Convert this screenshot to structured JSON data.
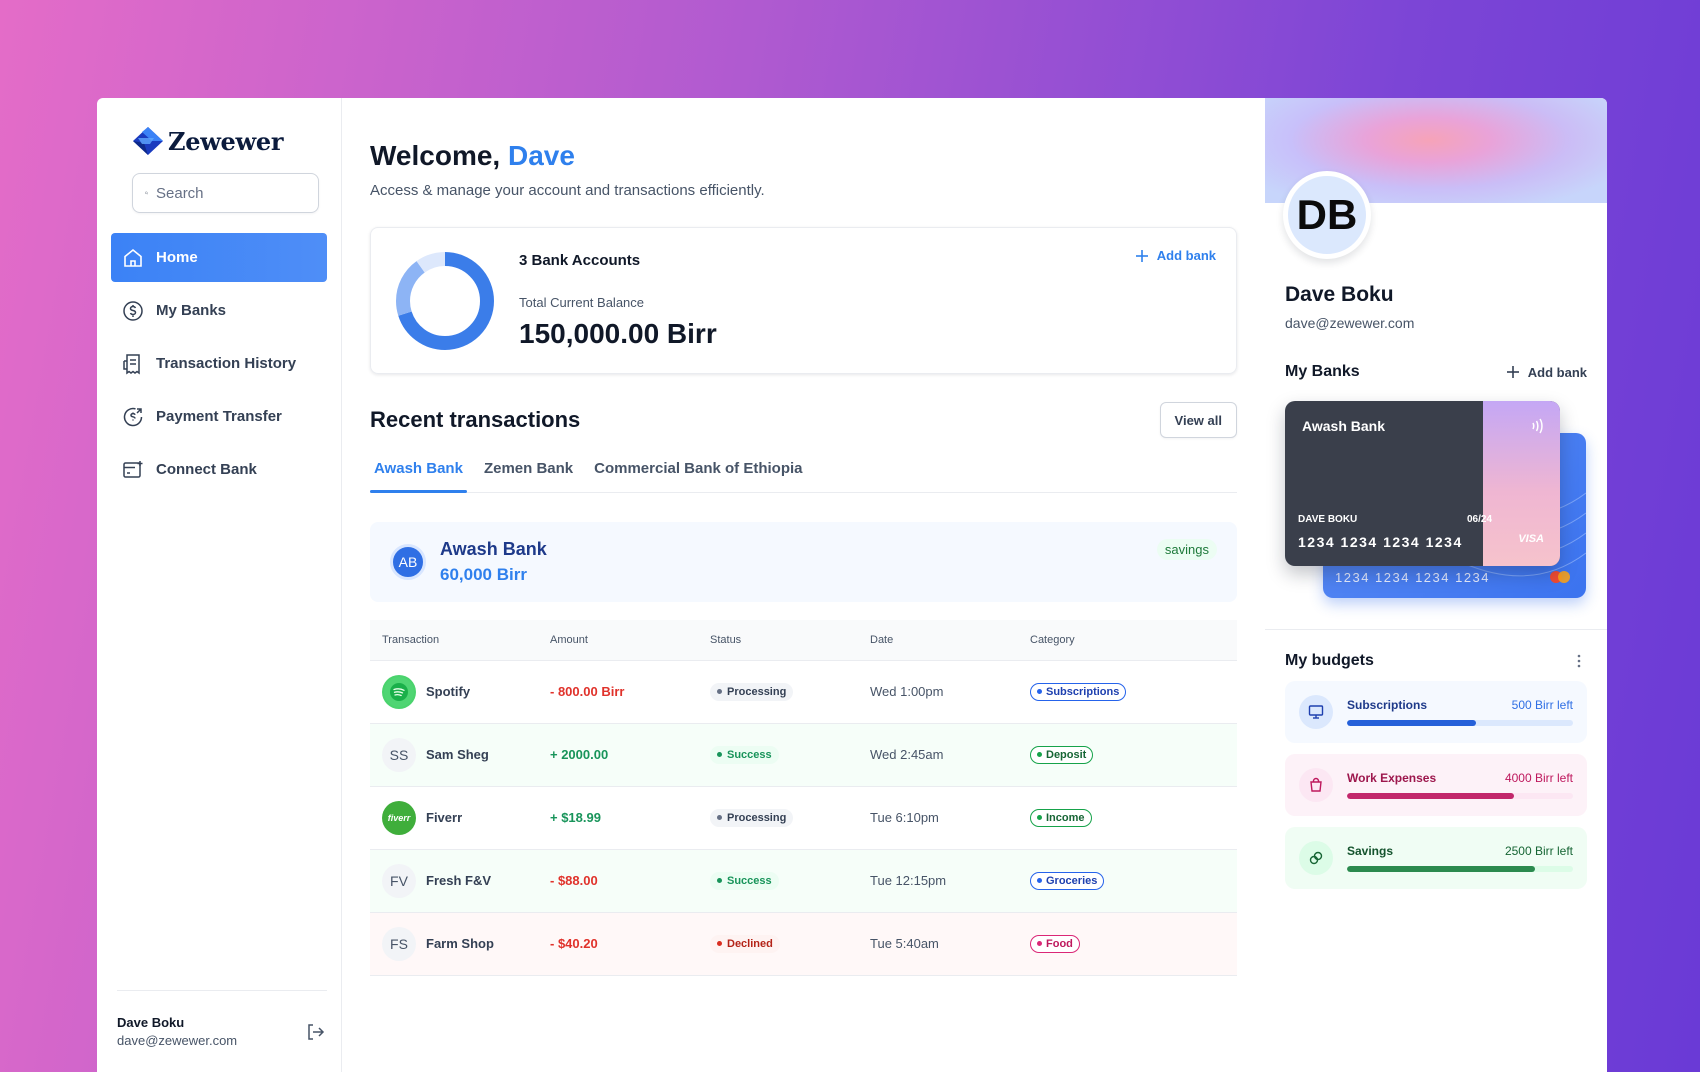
{
  "app": {
    "logo_text": "Zewewer"
  },
  "search": {
    "placeholder": "Search"
  },
  "sidebar": {
    "items": [
      {
        "label": "Home",
        "icon": "home-icon"
      },
      {
        "label": "My Banks",
        "icon": "dollar-circle-icon"
      },
      {
        "label": "Transaction History",
        "icon": "receipt-icon"
      },
      {
        "label": "Payment Transfer",
        "icon": "money-send-icon"
      },
      {
        "label": "Connect Bank",
        "icon": "card-add-icon"
      }
    ],
    "footer": {
      "name": "Dave Boku",
      "email": "dave@zewewer.com"
    }
  },
  "header": {
    "welcome_prefix": "Welcome,",
    "user_first_name": "Dave",
    "subtitle": "Access & manage your account and transactions efficiently."
  },
  "balance": {
    "accounts_label": "3 Bank Accounts",
    "total_label": "Total Current Balance",
    "total_value": "150,000.00 Birr",
    "add_bank_label": "Add bank",
    "donut_shares": [
      0.7,
      0.2,
      0.1
    ],
    "donut_colors": [
      "#3b7de9",
      "#8db4f5",
      "#dde8fc"
    ]
  },
  "recent": {
    "title": "Recent transactions",
    "view_all_label": "View all",
    "tabs": [
      "Awash Bank",
      "Zemen Bank",
      "Commercial Bank of Ethiopia"
    ],
    "selected_bank": {
      "initials": "AB",
      "name": "Awash Bank",
      "amount": "60,000 Birr",
      "type": "savings"
    },
    "columns": [
      "Transaction",
      "Amount",
      "Status",
      "Date",
      "Category"
    ],
    "rows": [
      {
        "name": "Spotify",
        "avatar": "spotify",
        "amount": "- 800.00 Birr",
        "direction": "neg",
        "status": "Processing",
        "date": "Wed 1:00pm",
        "category": "Subscriptions",
        "category_color": "blue",
        "tint": ""
      },
      {
        "name": "Sam Sheg",
        "avatar_initials": "SS",
        "amount": "+ 2000.00",
        "direction": "pos",
        "status": "Success",
        "date": "Wed 2:45am",
        "category": "Deposit",
        "category_color": "green",
        "tint": "green"
      },
      {
        "name": "Fiverr",
        "avatar": "fiverr",
        "avatar_text": "fiverr",
        "amount": "+ $18.99",
        "direction": "pos",
        "status": "Processing",
        "date": "Tue 6:10pm",
        "category": "Income",
        "category_color": "green",
        "tint": ""
      },
      {
        "name": "Fresh F&V",
        "avatar_initials": "FV",
        "amount": "- $88.00",
        "direction": "neg",
        "status": "Success",
        "date": "Tue 12:15pm",
        "category": "Groceries",
        "category_color": "blue",
        "tint": "green"
      },
      {
        "name": "Farm Shop",
        "avatar_initials": "FS",
        "amount": "- $40.20",
        "direction": "neg",
        "status": "Declined",
        "date": "Tue 5:40am",
        "category": "Food",
        "category_color": "pink",
        "tint": "red"
      }
    ]
  },
  "profile": {
    "initials": "DB",
    "name": "Dave Boku",
    "email": "dave@zewewer.com"
  },
  "my_banks": {
    "title": "My Banks",
    "add_bank_label": "Add bank",
    "card": {
      "bank": "Awash Bank",
      "holder": "DAVE BOKU",
      "expiry": "06/24",
      "number": "1234 1234 1234 1234",
      "brand": "VISA"
    },
    "back_card_number": "1234 1234 1234 1234"
  },
  "budgets": {
    "title": "My budgets",
    "items": [
      {
        "name": "Subscriptions",
        "left": "500 Birr left",
        "progress": 0.57,
        "color": "blue",
        "icon": "monitor-icon"
      },
      {
        "name": "Work Expenses",
        "left": "4000 Birr left",
        "progress": 0.74,
        "color": "pink",
        "icon": "bag-icon"
      },
      {
        "name": "Savings",
        "left": "2500 Birr left",
        "progress": 0.83,
        "color": "green",
        "icon": "link-icon"
      }
    ]
  }
}
